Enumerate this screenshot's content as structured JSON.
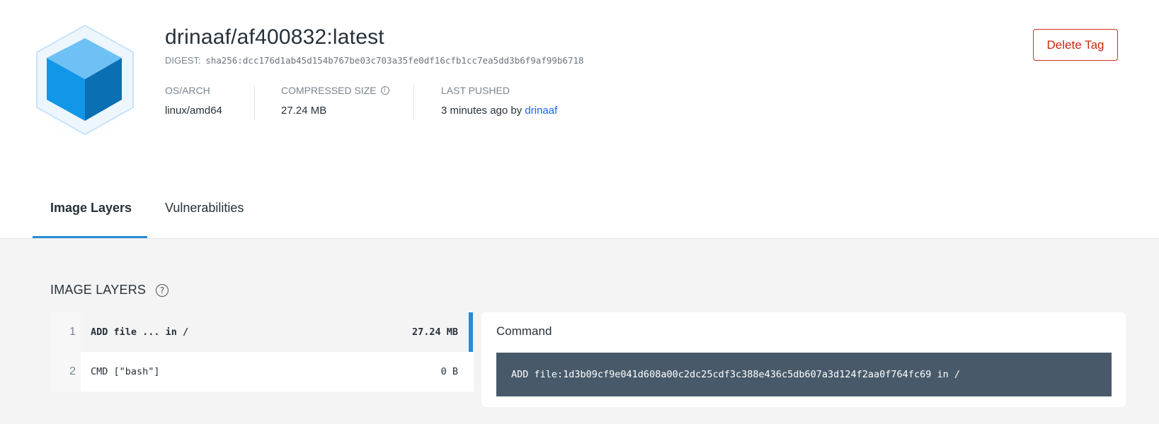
{
  "header": {
    "logo_icon": "cube-icon",
    "title": "drinaaf/af400832:latest",
    "digest_label": "DIGEST:",
    "digest_value": "sha256:dcc176d1ab45d154b767be03c703a35fe0df16cfb1cc7ea5dd3b6f9af99b6718",
    "meta": [
      {
        "label": "OS/ARCH",
        "value": "linux/amd64"
      },
      {
        "label": "COMPRESSED SIZE",
        "value": "27.24 MB",
        "icon": "info-icon"
      },
      {
        "label": "LAST PUSHED",
        "value_prefix": "3 minutes ago by",
        "user": "drinaaf"
      }
    ],
    "delete_button": "Delete Tag",
    "delete_color": "#c8280f"
  },
  "tabs": [
    {
      "label": "Image Layers",
      "active": true
    },
    {
      "label": "Vulnerabilities",
      "active": false
    }
  ],
  "layers_section": {
    "title": "IMAGE LAYERS",
    "help_icon": "question-circle-icon",
    "layers": [
      {
        "index": "1",
        "command": "ADD file ... in /",
        "size": "27.24 MB",
        "selected": true
      },
      {
        "index": "2",
        "command": "CMD [\"bash\"]",
        "size": "0 B",
        "selected": false
      }
    ],
    "accent": "#2a8bd4"
  },
  "command_panel": {
    "title": "Command",
    "text": "ADD file:1d3b09cf9e041d608a00c2dc25cdf3c388e436c5db607a3d124f2aa0f764fc69 in /"
  }
}
